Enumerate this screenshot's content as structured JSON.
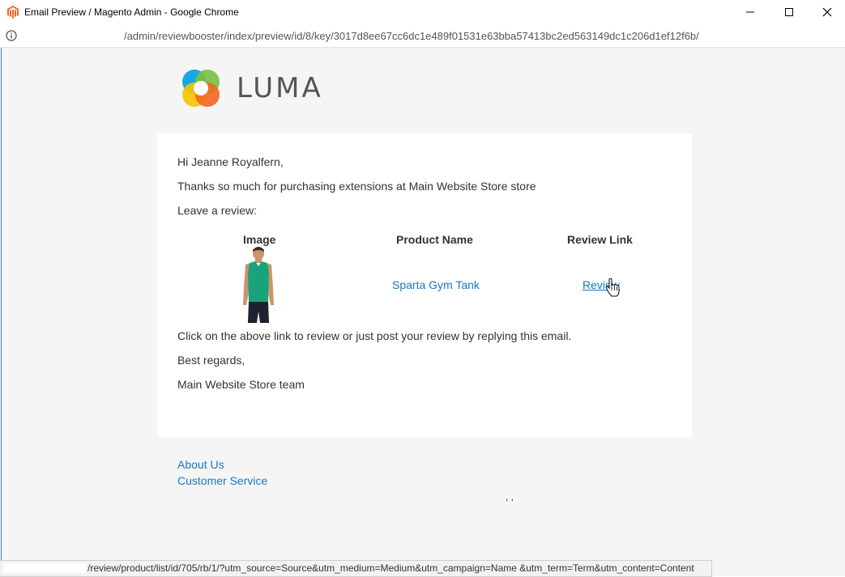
{
  "window": {
    "title": "Email Preview / Magento Admin - Google Chrome",
    "icon": "magento-icon",
    "controls": [
      "minimize-icon",
      "maximize-icon",
      "close-icon"
    ]
  },
  "address_bar": {
    "icon": "info-icon",
    "url": "/admin/reviewbooster/index/preview/id/8/key/3017d8ee67cc6dc1e489f01531e63bba57413bc2ed563149dc1c206d1ef12f6b/"
  },
  "logo": {
    "text": "LUMA",
    "colors": [
      "#00a0e3",
      "#7ac143",
      "#f8c400",
      "#f26722"
    ]
  },
  "email": {
    "greeting": "Hi Jeanne Royalfern,",
    "thanks": "Thanks so much for purchasing extensions at Main Website Store store",
    "prompt": "Leave a review:",
    "table": {
      "headers": [
        "Image",
        "Product Name",
        "Review Link"
      ],
      "rows": [
        {
          "image": "product-image",
          "product_name": "Sparta Gym Tank",
          "review_link": "Review"
        }
      ]
    },
    "instructions": "Click on the above link to review or just post your review by replying this email.",
    "closing": "Best regards,",
    "signature": "Main Website Store team"
  },
  "footer": {
    "links": [
      "About Us",
      "Customer Service"
    ],
    "address": ", ,"
  },
  "status_bar": {
    "url": "/review/product/list/id/705/rb/1/?utm_source=Source&utm_medium=Medium&utm_campaign=Name &utm_term=Term&utm_content=Content"
  },
  "colors": {
    "link": "#1979c3",
    "page_background": "#f5f5f5",
    "magento_orange": "#f26322",
    "product_shirt": "#1aa37a"
  }
}
